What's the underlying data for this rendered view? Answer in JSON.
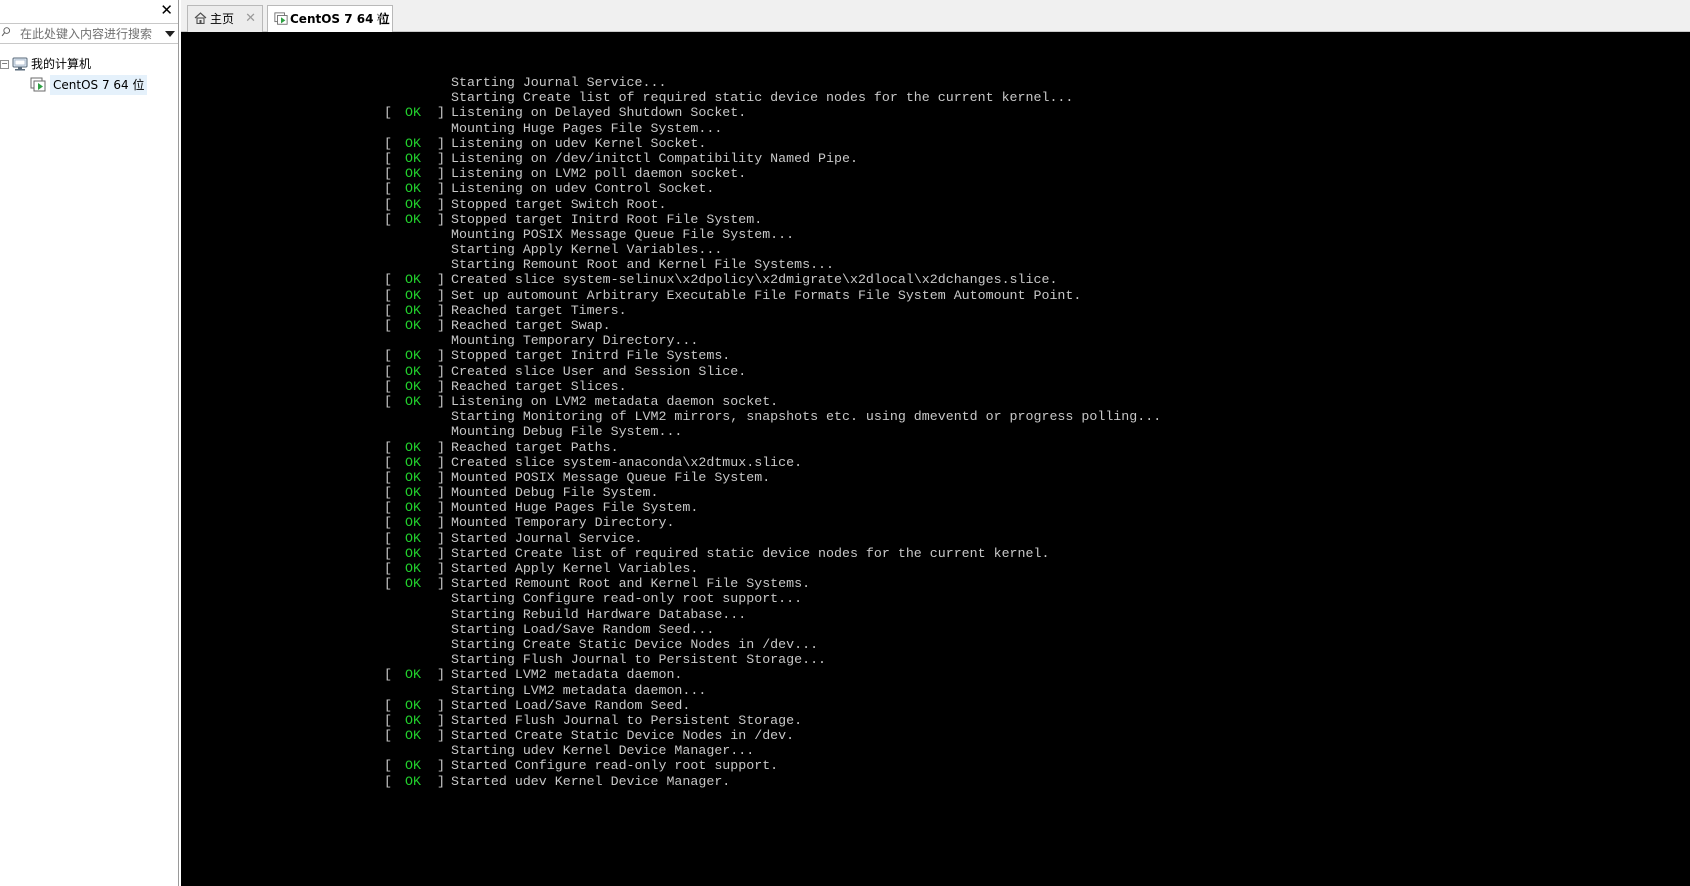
{
  "sidebar": {
    "close_symbol": "✕",
    "search": {
      "placeholder": "在此处键入内容进行搜索",
      "icon": "search-icon",
      "dropdown_icon": "dropdown-arrow-icon"
    },
    "tree": {
      "root": {
        "label": "我的计算机",
        "toggle": "⊟",
        "icon": "computer-icon"
      },
      "vm": {
        "label": "CentOS 7 64 位",
        "icon": "vm-running-icon"
      }
    }
  },
  "tabs": [
    {
      "label": "主页",
      "icon": "home-icon",
      "close": "✕"
    },
    {
      "label": "CentOS 7 64 位",
      "icon": "vm-running-icon",
      "close": "✕",
      "active": true
    }
  ],
  "console": {
    "background": "#000000",
    "text_color": "#c8c8c8",
    "ok_color": "#22d22d",
    "lines": [
      {
        "status": "",
        "text": "Starting Journal Service..."
      },
      {
        "status": "",
        "text": "Starting Create list of required static device nodes for the current kernel..."
      },
      {
        "status": "OK",
        "text": "Listening on Delayed Shutdown Socket."
      },
      {
        "status": "",
        "text": "Mounting Huge Pages File System..."
      },
      {
        "status": "OK",
        "text": "Listening on udev Kernel Socket."
      },
      {
        "status": "OK",
        "text": "Listening on /dev/initctl Compatibility Named Pipe."
      },
      {
        "status": "OK",
        "text": "Listening on LVM2 poll daemon socket."
      },
      {
        "status": "OK",
        "text": "Listening on udev Control Socket."
      },
      {
        "status": "OK",
        "text": "Stopped target Switch Root."
      },
      {
        "status": "OK",
        "text": "Stopped target Initrd Root File System."
      },
      {
        "status": "",
        "text": "Mounting POSIX Message Queue File System..."
      },
      {
        "status": "",
        "text": "Starting Apply Kernel Variables..."
      },
      {
        "status": "",
        "text": "Starting Remount Root and Kernel File Systems..."
      },
      {
        "status": "OK",
        "text": "Created slice system-selinux\\x2dpolicy\\x2dmigrate\\x2dlocal\\x2dchanges.slice."
      },
      {
        "status": "OK",
        "text": "Set up automount Arbitrary Executable File Formats File System Automount Point."
      },
      {
        "status": "OK",
        "text": "Reached target Timers."
      },
      {
        "status": "OK",
        "text": "Reached target Swap."
      },
      {
        "status": "",
        "text": "Mounting Temporary Directory..."
      },
      {
        "status": "OK",
        "text": "Stopped target Initrd File Systems."
      },
      {
        "status": "OK",
        "text": "Created slice User and Session Slice."
      },
      {
        "status": "OK",
        "text": "Reached target Slices."
      },
      {
        "status": "OK",
        "text": "Listening on LVM2 metadata daemon socket."
      },
      {
        "status": "",
        "text": "Starting Monitoring of LVM2 mirrors, snapshots etc. using dmeventd or progress polling..."
      },
      {
        "status": "",
        "text": "Mounting Debug File System..."
      },
      {
        "status": "OK",
        "text": "Reached target Paths."
      },
      {
        "status": "OK",
        "text": "Created slice system-anaconda\\x2dtmux.slice."
      },
      {
        "status": "OK",
        "text": "Mounted POSIX Message Queue File System."
      },
      {
        "status": "OK",
        "text": "Mounted Debug File System."
      },
      {
        "status": "OK",
        "text": "Mounted Huge Pages File System."
      },
      {
        "status": "OK",
        "text": "Mounted Temporary Directory."
      },
      {
        "status": "OK",
        "text": "Started Journal Service."
      },
      {
        "status": "OK",
        "text": "Started Create list of required static device nodes for the current kernel."
      },
      {
        "status": "OK",
        "text": "Started Apply Kernel Variables."
      },
      {
        "status": "OK",
        "text": "Started Remount Root and Kernel File Systems."
      },
      {
        "status": "",
        "text": "Starting Configure read-only root support..."
      },
      {
        "status": "",
        "text": "Starting Rebuild Hardware Database..."
      },
      {
        "status": "",
        "text": "Starting Load/Save Random Seed..."
      },
      {
        "status": "",
        "text": "Starting Create Static Device Nodes in /dev..."
      },
      {
        "status": "",
        "text": "Starting Flush Journal to Persistent Storage..."
      },
      {
        "status": "OK",
        "text": "Started LVM2 metadata daemon."
      },
      {
        "status": "",
        "text": "Starting LVM2 metadata daemon..."
      },
      {
        "status": "OK",
        "text": "Started Load/Save Random Seed."
      },
      {
        "status": "OK",
        "text": "Started Flush Journal to Persistent Storage."
      },
      {
        "status": "OK",
        "text": "Started Create Static Device Nodes in /dev."
      },
      {
        "status": "",
        "text": "Starting udev Kernel Device Manager..."
      },
      {
        "status": "OK",
        "text": "Started Configure read-only root support."
      },
      {
        "status": "OK",
        "text": "Started udev Kernel Device Manager."
      }
    ]
  }
}
